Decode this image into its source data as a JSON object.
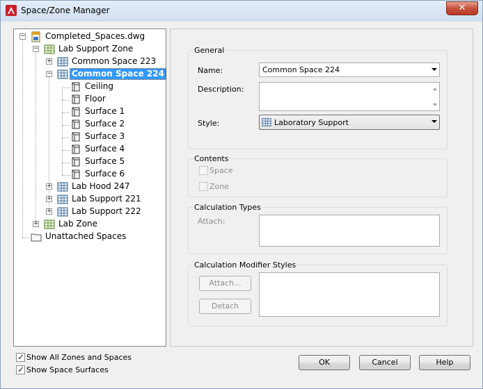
{
  "window": {
    "title": "Space/Zone Manager",
    "close_glyph": "✕"
  },
  "tree": {
    "root": "Completed_Spaces.dwg",
    "zone1": "Lab Support Zone",
    "cs223": "Common Space 223",
    "cs224": "Common Space 224",
    "ceiling": "Ceiling",
    "floor": "Floor",
    "s1": "Surface 1",
    "s2": "Surface 2",
    "s3": "Surface 3",
    "s4": "Surface 4",
    "s5": "Surface 5",
    "s6": "Surface 6",
    "hood247": "Lab Hood 247",
    "ls221": "Lab Support 221",
    "ls222": "Lab Support 222",
    "labzone": "Lab Zone",
    "unattached": "Unattached Spaces",
    "expand_plus": "+",
    "expand_minus": "−"
  },
  "general": {
    "title": "General",
    "name_label": "Name:",
    "name_value": "Common Space 224",
    "description_label": "Description:",
    "description_value": "",
    "style_label": "Style:",
    "style_value": "Laboratory Support"
  },
  "contents": {
    "title": "Contents",
    "space_label": "Space",
    "zone_label": "Zone"
  },
  "calc_types": {
    "title": "Calculation Types",
    "attach_label": "Attach:"
  },
  "calc_modifiers": {
    "title": "Calculation Modifier Styles",
    "attach_button": "Attach...",
    "detach_button": "Detach"
  },
  "bottom": {
    "show_all_label": "Show All Zones and Spaces",
    "show_surfaces_label": "Show Space Surfaces",
    "check_glyph": "✓",
    "ok": "OK",
    "cancel": "Cancel",
    "help": "Help"
  }
}
